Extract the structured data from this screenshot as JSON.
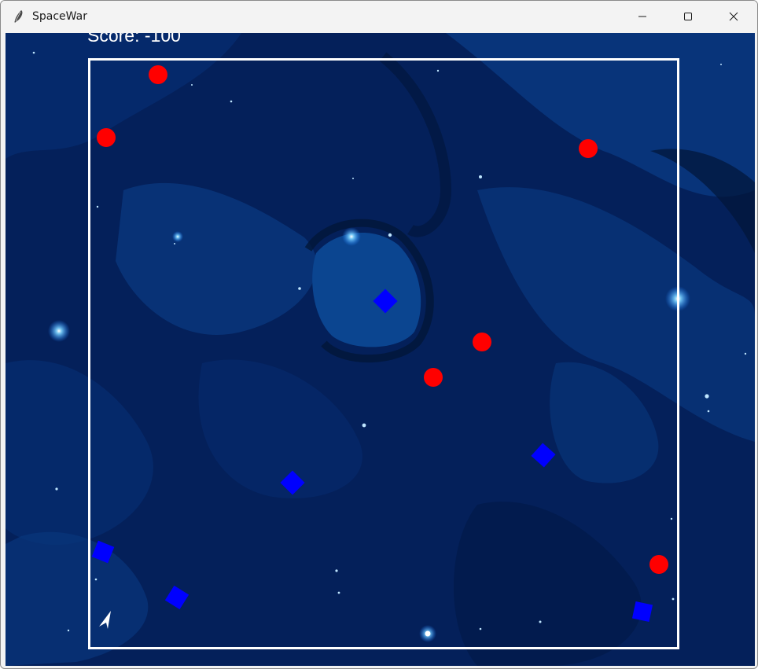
{
  "window": {
    "title": "SpaceWar",
    "icon": "feather-icon",
    "controls": [
      "minimize-icon",
      "maximize-icon",
      "close-icon"
    ]
  },
  "game": {
    "score_text": "Score: -100",
    "colors": {
      "background": "#04205a",
      "border": "#ffffff",
      "enemy": "#ff0000",
      "goal": "#0000ff",
      "player": "#ffffff"
    }
  }
}
